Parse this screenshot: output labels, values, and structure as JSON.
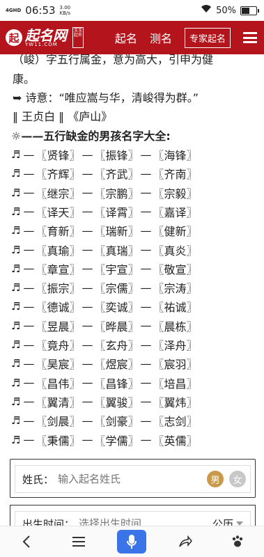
{
  "status": {
    "signal": "4GHD",
    "time": "06:53",
    "speed": "3.00",
    "speed_unit": "KB/s",
    "battery": "50%",
    "battery_level": 0.5
  },
  "nav": {
    "logo_text": "起名网",
    "logo_sub": "YW11.COM",
    "logo_seal": "宝宝起名",
    "items": [
      "起名",
      "测名"
    ],
    "expert": "专家起名"
  },
  "content": {
    "line1": "（峻）字五行属金，意为高大，引申为健",
    "line2": "康。",
    "poem": "➥ 诗意：“唯应嵩与华，清峻得为群。”",
    "source": "‖ 王贞白 ‖ 《庐山》",
    "heading": "☼——五行缺金的男孩名字大全:",
    "note": "♬",
    "dash": "—",
    "rows": [
      [
        "〖贤锋〗",
        "〖振锋〗",
        "〖海锋〗"
      ],
      [
        "〖齐辉〗",
        "〖齐武〗",
        "〖齐南〗"
      ],
      [
        "〖继宗〗",
        "〖宗鹏〗",
        "〖宗毅〗"
      ],
      [
        "〖译天〗",
        "〖译霄〗",
        "〖嘉译〗"
      ],
      [
        "〖育新〗",
        "〖瑞新〗",
        "〖健新〗"
      ],
      [
        "〖真瑜〗",
        "〖真瑞〗",
        "〖真炎〗"
      ],
      [
        "〖章宣〗",
        "〖宇宣〗",
        "〖敬宣〗"
      ],
      [
        "〖振宗〗",
        "〖宗儒〗",
        "〖宗涛〗"
      ],
      [
        "〖德诚〗",
        "〖奕诚〗",
        "〖祐诚〗"
      ],
      [
        "〖昱晨〗",
        "〖晔晨〗",
        "〖晨栋〗"
      ],
      [
        "〖竟舟〗",
        "〖玄舟〗",
        "〖泽舟〗"
      ],
      [
        "〖昊宸〗",
        "〖煜宸〗",
        "〖宸羽〗"
      ],
      [
        "〖昌伟〗",
        "〖昌锋〗",
        "〖培昌〗"
      ],
      [
        "〖翼清〗",
        "〖翼骏〗",
        "〖翼炜〗"
      ],
      [
        "〖剑晨〗",
        "〖剑豪〗",
        "〖志剑〗"
      ],
      [
        "〖秉儒〗",
        "〖学儒〗",
        "〖英儒〗"
      ]
    ]
  },
  "form": {
    "surname_label": "姓氏：",
    "surname_placeholder": "输入起名姓氏",
    "male": "男",
    "female": "女",
    "birth_label": "出生时间：",
    "birth_placeholder": "选择出生时间",
    "calendar": "公历"
  },
  "bottom": {
    "back_icon": "‹",
    "menu_icon": "☰",
    "share_icon": "➦",
    "paw_icon": "🐾"
  },
  "colors": {
    "brand": "#b4151c",
    "mic": "#3b73e8",
    "male": "#c89a4a"
  }
}
